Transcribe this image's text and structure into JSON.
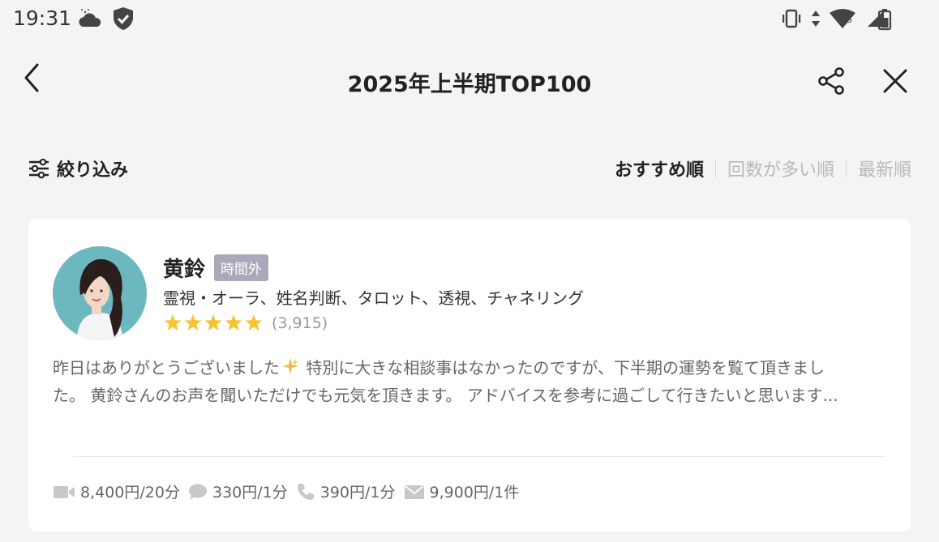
{
  "status_bar": {
    "time": "19:31",
    "icons_left": [
      "cloud-icon",
      "shield-icon"
    ],
    "icons_right": [
      "vibrate-icon",
      "data-arrows-icon",
      "wifi-icon",
      "signal-icon",
      "battery-icon"
    ],
    "wifi_badge": "5"
  },
  "header": {
    "title": "2025年上半期TOP100",
    "back_icon": "chevron-left-icon",
    "share_icon": "share-icon",
    "close_icon": "close-icon"
  },
  "filter": {
    "label": "絞り込み",
    "icon": "sliders-icon"
  },
  "sort": {
    "tabs": [
      {
        "label": "おすすめ順",
        "active": true
      },
      {
        "label": "回数が多い順",
        "active": false
      },
      {
        "label": "最新順",
        "active": false
      }
    ]
  },
  "card": {
    "name": "黄鈴",
    "badge": "時間外",
    "specialties": "霊視・オーラ、姓名判断、タロット、透視、チャネリング",
    "rating_stars": 5,
    "review_count": "(3,915)",
    "review_line1_a": "昨日はありがとうございました",
    "review_line1_b": " 特別に大きな相談事はなかったのですが、下半期の運勢を覧て頂きまし",
    "review_line2": "た。 黄鈴さんのお声を聞いただけでも元気を頂きます。 アドバイスを参考に過ごして行きたいと思います...",
    "prices": [
      {
        "icon": "video-icon",
        "text": "8,400円/20分"
      },
      {
        "icon": "chat-icon",
        "text": "330円/1分"
      },
      {
        "icon": "phone-icon",
        "text": "390円/1分"
      },
      {
        "icon": "mail-icon",
        "text": "9,900円/1件"
      }
    ]
  },
  "colors": {
    "background": "#f4f4f4",
    "card": "#ffffff",
    "star": "#f7c32e",
    "badge": "#a9a9b9",
    "avatar_bg": "#6cb8be"
  }
}
